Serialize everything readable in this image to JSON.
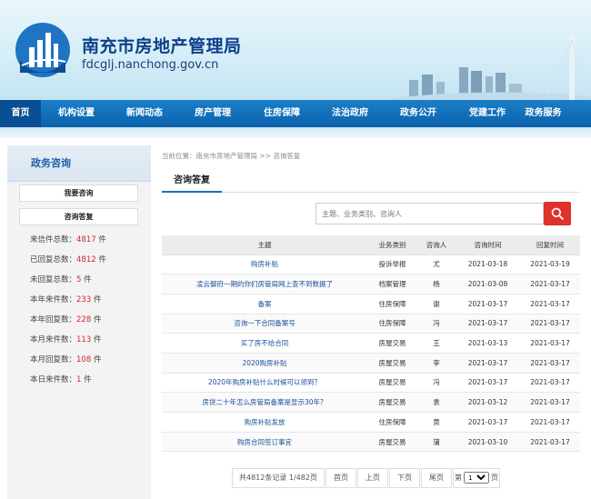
{
  "header": {
    "title": "南充市房地产管理局",
    "domain": "fdcglj.nanchong.gov.cn"
  },
  "nav": {
    "items": [
      {
        "label": "首页",
        "active": true
      },
      {
        "label": "机构设置"
      },
      {
        "label": "新闻动态"
      },
      {
        "label": "房产管理"
      },
      {
        "label": "住房保障"
      },
      {
        "label": "法治政府"
      },
      {
        "label": "政务公开"
      },
      {
        "label": "党建工作"
      },
      {
        "label": "政务服务"
      }
    ]
  },
  "sidebar": {
    "title": "政务咨询",
    "buttons": [
      "我要咨询",
      "咨询答复"
    ],
    "stats": [
      {
        "label": "来信件总数：",
        "value": "4817",
        "unit": " 件"
      },
      {
        "label": "已回复总数：",
        "value": "4812",
        "unit": " 件"
      },
      {
        "label": "未回复总数：",
        "value": "5",
        "unit": " 件"
      },
      {
        "label": "本年来件数：",
        "value": "233",
        "unit": " 件"
      },
      {
        "label": "本年回复数：",
        "value": "228",
        "unit": " 件"
      },
      {
        "label": "本月来件数：",
        "value": "113",
        "unit": " 件"
      },
      {
        "label": "本月回复数：",
        "value": "108",
        "unit": " 件"
      },
      {
        "label": "本日来件数：",
        "value": "1",
        "unit": " 件"
      }
    ]
  },
  "breadcrumb": "当前位置：南充市房地产管理局 >> 咨询答复",
  "panel_title": "咨询答复",
  "search": {
    "placeholder": "主题、业务类别、咨询人"
  },
  "table": {
    "headers": [
      "主题",
      "业务类别",
      "咨询人",
      "咨询时间",
      "回复时间"
    ],
    "rows": [
      [
        "购房补贴",
        "投诉举报",
        "尤",
        "2021-03-18",
        "2021-03-19"
      ],
      [
        "凌云御府一期的你们房管局网上查不到数据了",
        "档案管理",
        "杨",
        "2021-03-08",
        "2021-03-17"
      ],
      [
        "备案",
        "住房保障",
        "谢",
        "2021-03-17",
        "2021-03-17"
      ],
      [
        "咨询一下合同备案号",
        "住房保障",
        "冯",
        "2021-03-17",
        "2021-03-17"
      ],
      [
        "买了房不给合同",
        "房屋交易",
        "王",
        "2021-03-13",
        "2021-03-17"
      ],
      [
        "2020购房补贴",
        "房屋交易",
        "李",
        "2021-03-17",
        "2021-03-17"
      ],
      [
        "2020年购房补贴什么时候可以领到？",
        "房屋交易",
        "冯",
        "2021-03-17",
        "2021-03-17"
      ],
      [
        "房贷二十年怎么房管局备案是显示30年？",
        "房屋交易",
        "袁",
        "2021-03-12",
        "2021-03-17"
      ],
      [
        "购房补贴发放",
        "住房保障",
        "黄",
        "2021-03-17",
        "2021-03-17"
      ],
      [
        "购房合同签订事宜",
        "房屋交易",
        "蒲",
        "2021-03-10",
        "2021-03-17"
      ]
    ]
  },
  "pager": {
    "info": "共4812条记录 1/482页",
    "first": "首页",
    "prev": "上页",
    "next": "下页",
    "last": "尾页",
    "goto_prefix": "第",
    "goto_value": "1",
    "goto_suffix": "页"
  },
  "colors": {
    "nav": "#0b62ab",
    "accent": "#e0312c",
    "link": "#1a4e9a"
  },
  "icons": {
    "search": "search-icon",
    "logo": "bureau-logo"
  }
}
